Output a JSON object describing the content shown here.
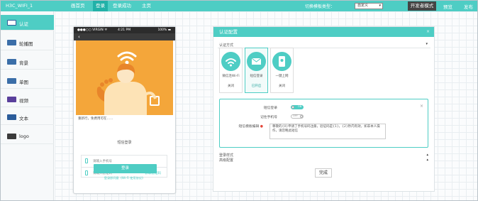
{
  "topbar": {
    "brand": "H3C_WIFI_1",
    "nav": [
      "画首页",
      "登录",
      "登录成功",
      "主页"
    ],
    "template_label": "切换模板类型：",
    "template_value": "自定义",
    "dev_mode": "开发者模式",
    "preview": "预览",
    "publish": "发布"
  },
  "sidebar": {
    "items": [
      {
        "label": "认证",
        "icon": "auth-icon"
      },
      {
        "label": "轮播图",
        "icon": "carousel-icon"
      },
      {
        "label": "背景",
        "icon": "background-icon"
      },
      {
        "label": "单图",
        "icon": "single-image-icon"
      },
      {
        "label": "视频",
        "icon": "video-icon"
      },
      {
        "label": "文本",
        "icon": "text-icon"
      },
      {
        "label": "logo",
        "icon": "logo-icon"
      }
    ]
  },
  "phone": {
    "carrier": "●●●○○ VIRGIN ᯤ",
    "time": "4:21 PM",
    "battery": "100% ▬",
    "back": "‹",
    "welcome": "重新行，免费用可在……",
    "sms_login": "短信登录",
    "phone_placeholder": "请输入手机号",
    "code_placeholder": "请输入验证码",
    "get_code": "获取验证码",
    "login_button": "登录",
    "agree_text": "登录即同意《Wi-Fi 使用协议》"
  },
  "panel": {
    "title": "认证配置",
    "close": "×",
    "auth_method_label": "认证方式",
    "methods": [
      {
        "title": "微信连Wi-Fi",
        "status": "关闭",
        "icon": "wifi-icon"
      },
      {
        "title": "短信登录",
        "status": "已开启",
        "icon": "sms-icon"
      },
      {
        "title": "一键上网",
        "status": "关闭",
        "icon": "one-click-icon"
      }
    ],
    "detail": {
      "sms_login_label": "短信登录",
      "sms_login_toggle": "ON",
      "remember_label": "记住手机号",
      "remember_toggle": "OFF",
      "template_label": "短信模板编辑",
      "template_text": "尊敬的{0}申请了手机号码注册，验证码是{1}，{2}秒内有效，如非本人操作，请忽略此短信",
      "close": "×"
    },
    "login_style": "登录样式",
    "advanced": "高级配置",
    "done": "完成"
  }
}
